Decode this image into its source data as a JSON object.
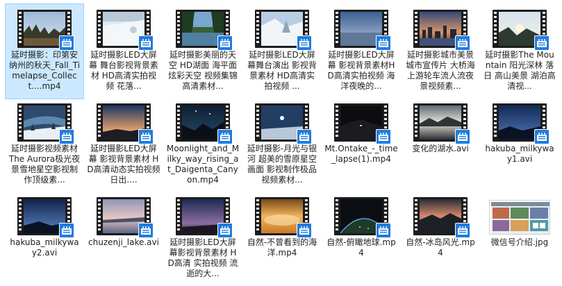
{
  "window": {
    "view": "large-icons"
  },
  "colors": {
    "selection": "#cce8ff",
    "badge": "#1f7ce0"
  },
  "files": [
    {
      "name": "延时摄影：印第安纳州的秋天_Fall_Timelapse_Collect....mp4",
      "kind": "video",
      "thumb": "autumn"
    },
    {
      "name": "延时摄影LED大屏幕 舞台影视背景素材 HD高清实拍视频 花落...",
      "kind": "video",
      "thumb": "snow"
    },
    {
      "name": "延时摄影美丽的天空 HD湖面 海平面 炫彩天空 视频集锦高清素材...",
      "kind": "video",
      "thumb": "lake"
    },
    {
      "name": "延时摄影LED大屏幕舞台演出 影视背景素材 HD高清实拍视频 ...",
      "kind": "video",
      "thumb": "snowtrees"
    },
    {
      "name": "延时摄影LED大屏幕 影视背景素材HD高清实拍视频 海洋夜晚的...",
      "kind": "video",
      "thumb": "ocean"
    },
    {
      "name": "延时摄影城市美景 城市宣传片 大桥海上游轮车流人流夜景视频素...",
      "kind": "video",
      "thumb": "city"
    },
    {
      "name": "延时摄影The Mountain 阳光深林 落日 高山美景 湖泊高清视...",
      "kind": "video",
      "thumb": "mountain"
    },
    {
      "name": "延时摄影视频素材 The Aurora极光夜景雪地星空影视制作顶级素...",
      "kind": "video",
      "thumb": "aurora"
    },
    {
      "name": "延时摄影LED大屏幕 影视背景素材 HD高清动态实拍视频 日出....",
      "kind": "video",
      "thumb": "sunrise"
    },
    {
      "name": "Moonlight_and_Milky_way_rising_at_Daigenta_Canyon.mp4",
      "kind": "video",
      "thumb": "canyon"
    },
    {
      "name": "延时摄影-月光与银河 超美的雪原星空画面 影视制作极品视频素材...",
      "kind": "video",
      "thumb": "moon"
    },
    {
      "name": "Mt.Ontake_-_time_lapse(1).mp4",
      "kind": "video",
      "thumb": "ontake"
    },
    {
      "name": "变化的湖水.avi",
      "kind": "video",
      "thumb": "mistlake"
    },
    {
      "name": "hakuba_milkyway1.avi",
      "kind": "video",
      "thumb": "hakuba1"
    },
    {
      "name": "hakuba_milkyway2.avi",
      "kind": "video",
      "thumb": "hakuba2"
    },
    {
      "name": "chuzenji_lake.avi",
      "kind": "video",
      "thumb": "chuzenji"
    },
    {
      "name": "延时摄影LED大屏幕影视背景素材 HD高清 实拍视频 流逝的大...",
      "kind": "video",
      "thumb": "clouds"
    },
    {
      "name": "自然-不曾看到的海洋.mp4",
      "kind": "video",
      "thumb": "golden"
    },
    {
      "name": "自然-俯瞰地球.mp4",
      "kind": "video",
      "thumb": "earth"
    },
    {
      "name": "自然-冰岛风光.mp4",
      "kind": "video",
      "thumb": "iceland"
    },
    {
      "name": "微信号介绍.jpg",
      "kind": "image",
      "thumb": "wechat"
    }
  ]
}
